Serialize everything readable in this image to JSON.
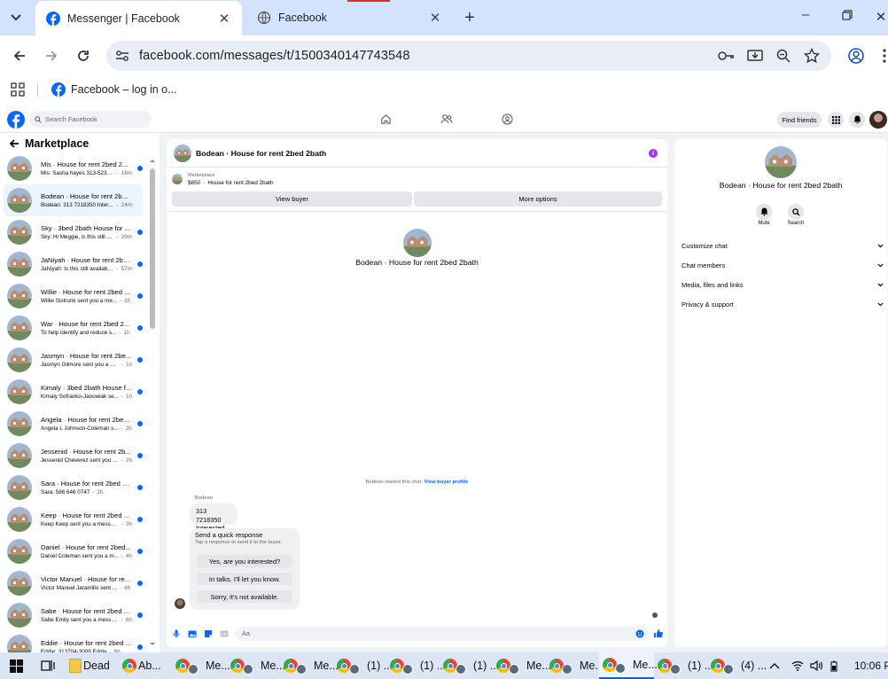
{
  "browser": {
    "tabs": [
      {
        "title": "Messenger | Facebook",
        "active": true
      },
      {
        "title": "Facebook",
        "active": false
      }
    ],
    "url": "facebook.com/messages/t/1500340147743548",
    "bookmarks": [
      {
        "label": "Facebook – log in o..."
      }
    ]
  },
  "fb_header": {
    "search_placeholder": "Search Facebook",
    "find_friends": "Find friends"
  },
  "sidebar": {
    "title": "Marketplace",
    "conversations": [
      {
        "name": "Mis · House for rent 2bed 2...",
        "preview": "Mis: Sasha hayes 313-523-8...",
        "time": "16m",
        "unread": true
      },
      {
        "name": "Bodean · House for rent 2bed ...",
        "preview": "Bodean: 313 7218350 Interested",
        "time": "24m",
        "unread": false,
        "selected": true
      },
      {
        "name": "Sky · 3bed 2bath House for ...",
        "preview": "Sky: Hi Meggie, is this still a...",
        "time": "29m",
        "unread": true
      },
      {
        "name": "JaNiyah · House for rent 2be...",
        "preview": "JaNiyah: Is this still available?",
        "time": "57m",
        "unread": true
      },
      {
        "name": "Willie · House for rent 2bed ...",
        "preview": "Willie Sistrunk sent you a me...",
        "time": "1h",
        "unread": true
      },
      {
        "name": "War · House for rent 2bed 2...",
        "preview": "To help identify and reduce s...",
        "time": "1h",
        "unread": true
      },
      {
        "name": "Jasmyn · House for rent 2be...",
        "preview": "Jasmyn Gilmore sent you a m...",
        "time": "1h",
        "unread": true
      },
      {
        "name": "Kimaly · 3bed 2bath House f...",
        "preview": "Kimaly Sofranko-Janowiak se...",
        "time": "1h",
        "unread": true
      },
      {
        "name": "Angela · House for rent 2be...",
        "preview": "Angela L Johnson-Coleman s...",
        "time": "2h",
        "unread": true
      },
      {
        "name": "Jessenid · House for rent 2b...",
        "preview": "Jessenid Cheverez sent you a ...",
        "time": "2h",
        "unread": true
      },
      {
        "name": "Sara · House for rent 2bed 2b...",
        "preview": "Sara: 586 646 0747",
        "time": "2h",
        "unread": true
      },
      {
        "name": "Keep · House for rent 2bed ...",
        "preview": "Keep Keep sent you a messag...",
        "time": "3h",
        "unread": true
      },
      {
        "name": "Daniel · House for rent 2bed...",
        "preview": "Daniel Coleman sent you a m...",
        "time": "4h",
        "unread": true
      },
      {
        "name": "Victor Manuel · House for re...",
        "preview": "Victor Manuel Jaramillo sent ...",
        "time": "4h",
        "unread": true
      },
      {
        "name": "Sabe · House for rent 2bed ...",
        "preview": "Sabe Emily sent you a messag...",
        "time": "6h",
        "unread": true
      },
      {
        "name": "Eddie · House for rent 2bed ...",
        "preview": "Eddie: 313704-3009 Eddie",
        "time": "6h",
        "unread": true
      }
    ]
  },
  "chat": {
    "title": "Bodean · House for rent 2bed 2bath",
    "listing_label": "Marketplace",
    "listing_price": "$850",
    "listing_name": "House for rent 2bed 2bath",
    "view_buyer": "View buyer",
    "more_options": "More options",
    "intro_name": "Bodean · House for rent 2bed 2bath",
    "started_text": "Bodean started this chat.",
    "view_profile": "View buyer profile",
    "sender": "Bodean",
    "message_line1": "313 7218350",
    "message_line2": "Interested",
    "quick_title": "Send a quick response",
    "quick_subtitle": "Tap a response to send it to the buyer.",
    "quick_responses": [
      "Yes, are you interested?",
      "In talks. I'll let you know.",
      "Sorry, it's not available."
    ],
    "composer_placeholder": "Aa"
  },
  "right_panel": {
    "title": "Bodean · House for rent 2bed 2bath",
    "mute": "Mute",
    "search": "Search",
    "sections": [
      "Customize chat",
      "Chat members",
      "Media, files and links",
      "Privacy & support"
    ]
  },
  "taskbar": {
    "items": [
      "Dead",
      "Ab...",
      "Me...",
      "Me...",
      "Me...",
      "(1) ...",
      "(1) ...",
      "(1) ...",
      "Me...",
      "Me...",
      "Me...",
      "(1) ...",
      "(4) ..."
    ],
    "clock": "10:06 P"
  },
  "colors": {
    "accent": "#0866ff",
    "tab_strip": "#d3e3fd",
    "selected_row": "#ebf5ff",
    "info_purple": "#a033ff"
  }
}
